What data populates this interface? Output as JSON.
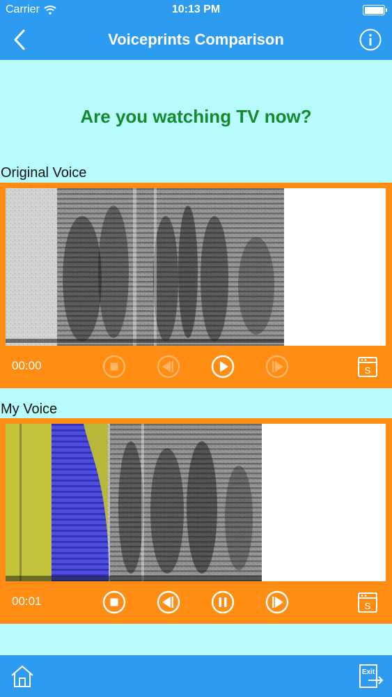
{
  "status_bar": {
    "carrier": "Carrier",
    "time": "10:13 PM",
    "battery_percent": 100
  },
  "nav": {
    "title": "Voiceprints Comparison",
    "back_icon": "chevron-left-icon",
    "info_icon": "info-icon"
  },
  "question": "Are you watching TV now?",
  "original": {
    "label": "Original Voice",
    "time": "00:00",
    "controls": [
      {
        "name": "stop",
        "icon": "stop-icon",
        "enabled": false
      },
      {
        "name": "rewind",
        "icon": "rewind-icon",
        "enabled": false
      },
      {
        "name": "play",
        "icon": "play-icon",
        "enabled": true
      },
      {
        "name": "forward",
        "icon": "forward-icon",
        "enabled": false
      }
    ],
    "s_button_text": "S"
  },
  "my_voice": {
    "label": "My Voice",
    "time": "00:01",
    "controls": [
      {
        "name": "stop",
        "icon": "stop-icon",
        "enabled": true
      },
      {
        "name": "rewind",
        "icon": "rewind-icon",
        "enabled": true
      },
      {
        "name": "pause",
        "icon": "pause-icon",
        "enabled": true
      },
      {
        "name": "forward",
        "icon": "forward-icon",
        "enabled": true
      }
    ],
    "s_button_text": "S"
  },
  "bottom_bar": {
    "home_icon": "home-icon",
    "exit_label": "Exit"
  },
  "colors": {
    "nav_blue": "#2d9bf0",
    "background": "#b8fbfd",
    "panel_orange": "#ff8d14",
    "question_green": "#148a2e",
    "highlight_yellow": "#c8c83a",
    "highlight_blue": "#3a3aeb"
  }
}
